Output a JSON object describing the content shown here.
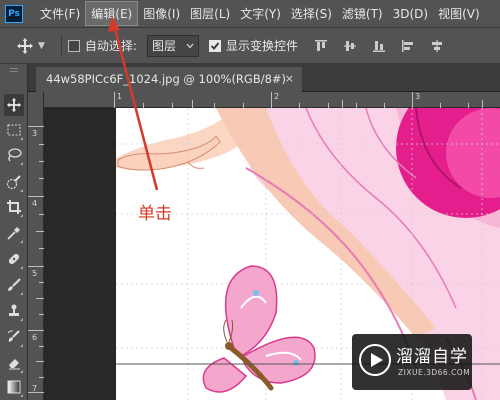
{
  "app": {
    "logo_text": "Ps"
  },
  "menu": {
    "items": [
      {
        "label": "文件(F)"
      },
      {
        "label": "编辑(E)"
      },
      {
        "label": "图像(I)"
      },
      {
        "label": "图层(L)"
      },
      {
        "label": "文字(Y)"
      },
      {
        "label": "选择(S)"
      },
      {
        "label": "滤镜(T)"
      },
      {
        "label": "3D(D)"
      },
      {
        "label": "视图(V)"
      }
    ],
    "highlighted_index": 1
  },
  "options": {
    "auto_select_label": "自动选择:",
    "auto_select_checked": false,
    "layer_dropdown_value": "图层",
    "show_transform_label": "显示变换控件",
    "show_transform_checked": true
  },
  "document": {
    "tab_title": "44w58PICc6F_1024.jpg @ 100%(RGB/8#)",
    "close_glyph": "×"
  },
  "tools": [
    {
      "name": "move-tool-icon",
      "active": true
    },
    {
      "name": "marquee-tool-icon"
    },
    {
      "name": "lasso-tool-icon"
    },
    {
      "name": "quick-selection-tool-icon"
    },
    {
      "name": "crop-tool-icon"
    },
    {
      "name": "eyedropper-tool-icon"
    },
    {
      "name": "healing-brush-tool-icon"
    },
    {
      "name": "brush-tool-icon"
    },
    {
      "name": "clone-stamp-tool-icon"
    },
    {
      "name": "history-brush-tool-icon"
    },
    {
      "name": "eraser-tool-icon"
    },
    {
      "name": "gradient-tool-icon"
    }
  ],
  "rulers": {
    "top_labels": [
      "1",
      "2",
      "3"
    ],
    "left_labels": [
      "3",
      "4",
      "5",
      "6",
      "7"
    ]
  },
  "annotation": {
    "text": "单击",
    "color": "#d33a2a"
  },
  "watermark": {
    "title": "溜溜自学",
    "subtitle": "ZIXUE.3D66.COM"
  },
  "colors": {
    "panel_bg": "#535353",
    "workspace_bg": "#282828",
    "accent_ps": "#31a8ff",
    "annotation_red": "#d33a2a"
  }
}
